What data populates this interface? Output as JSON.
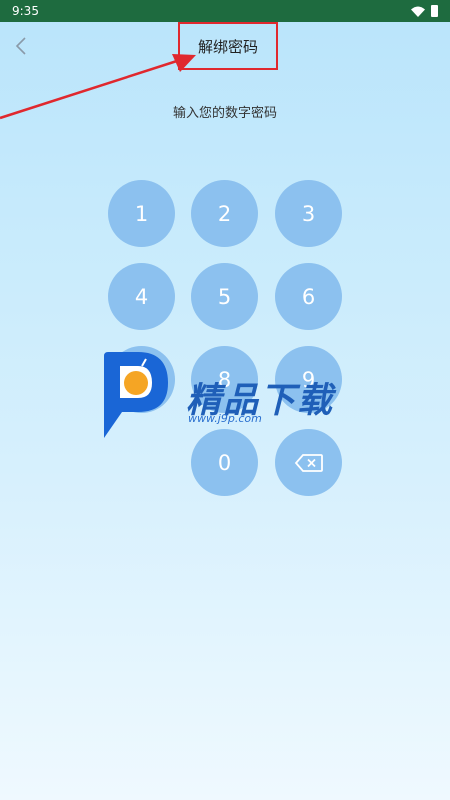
{
  "status_bar": {
    "time": "9:35"
  },
  "header": {
    "title": "解绑密码",
    "back_icon": "chevron-left-icon"
  },
  "prompt": "输入您的数字密码",
  "keypad": {
    "keys": [
      "1",
      "2",
      "3",
      "4",
      "5",
      "6",
      "7",
      "8",
      "9",
      "0"
    ],
    "delete_icon": "backspace-icon"
  },
  "watermark": {
    "brand": "精品下载",
    "url": "www.j9p.com"
  },
  "colors": {
    "status_bar": "#1e6b3f",
    "key_fill": "#8cc1ef",
    "highlight": "#e0282e",
    "watermark": "#1f5fb8"
  }
}
